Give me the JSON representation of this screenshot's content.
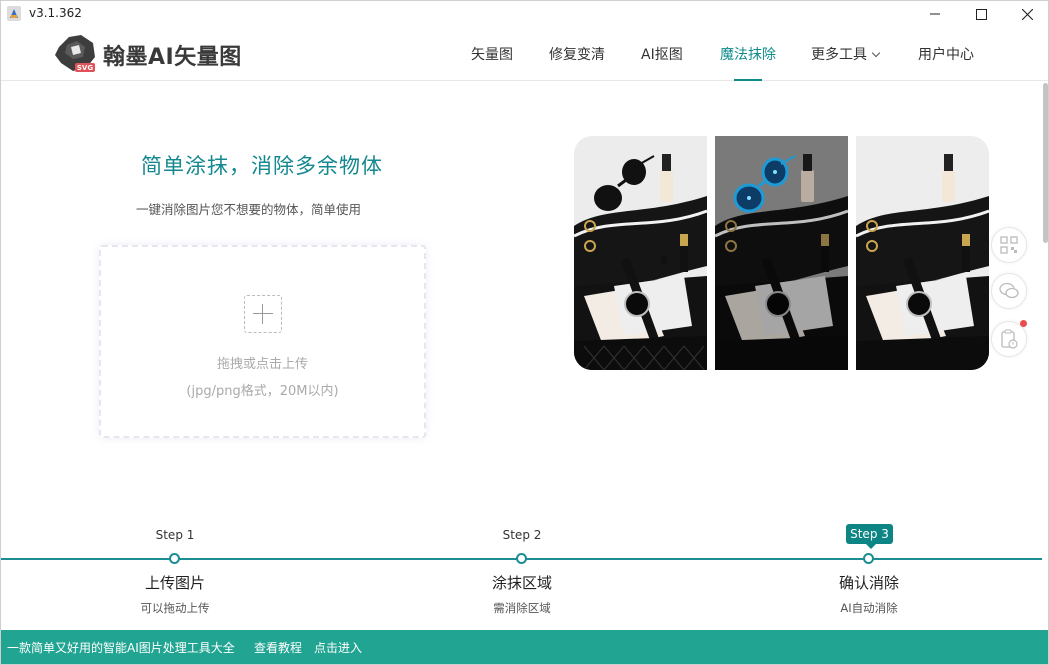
{
  "window": {
    "version": "v3.1.362"
  },
  "brand": {
    "name": "翰墨AI矢量图",
    "logo_badge": "SVG"
  },
  "nav": {
    "items": [
      {
        "label": "矢量图"
      },
      {
        "label": "修复变清"
      },
      {
        "label": "AI抠图"
      },
      {
        "label": "魔法抹除",
        "active": true
      },
      {
        "label": "更多工具"
      },
      {
        "label": "用户中心"
      }
    ]
  },
  "hero": {
    "title": "简单涂抹，消除多余物体",
    "subtitle": "一键消除图片您不想要的物体，简单使用"
  },
  "upload": {
    "label": "拖拽或点击上传",
    "hint": "(jpg/png格式，20M以内)"
  },
  "steps": [
    {
      "tag": "Step 1",
      "title": "上传图片",
      "desc": "可以拖动上传",
      "active": false
    },
    {
      "tag": "Step 2",
      "title": "涂抹区域",
      "desc": "需消除区域",
      "active": false
    },
    {
      "tag": "Step 3",
      "title": "确认消除",
      "desc": "AI自动消除",
      "active": true
    }
  ],
  "footer": {
    "slogan": "一款简单又好用的智能AI图片处理工具大全",
    "tutorial_link": "查看教程",
    "enter_link": "点击进入"
  },
  "float_tools": [
    {
      "icon": "qrcode-icon"
    },
    {
      "icon": "wechat-icon"
    },
    {
      "icon": "clipboard-clock-icon"
    }
  ],
  "colors": {
    "accent": "#0e8b8b",
    "footer_bg": "#21a592",
    "highlight": "#1e9bd6"
  }
}
